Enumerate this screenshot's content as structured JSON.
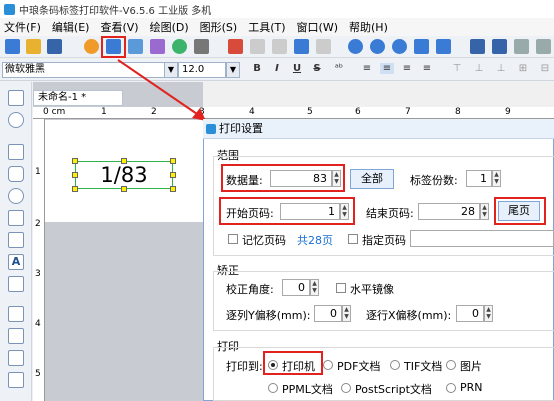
{
  "app": {
    "title": "中琅条码标签打印软件-V6.5.6 工业版 多机"
  },
  "menu": [
    "文件(F)",
    "编辑(E)",
    "查看(V)",
    "绘图(D)",
    "图形(S)",
    "工具(T)",
    "窗口(W)",
    "帮助(H)"
  ],
  "format": {
    "font": "微软雅黑",
    "size": "12.0",
    "bold": "B",
    "italic": "I",
    "underline": "U",
    "strike": "S"
  },
  "document": {
    "tab": "未命名-1 *",
    "label_text": "1/83",
    "ruler_unit": "0 cm",
    "ruler_top": [
      "1",
      "2",
      "3",
      "4",
      "5",
      "6",
      "7",
      "8",
      "9"
    ],
    "ruler_left": [
      "1",
      "2",
      "3",
      "4",
      "5"
    ]
  },
  "dialog": {
    "title": "打印设置",
    "range": {
      "title": "范围",
      "data_count_label": "数据量:",
      "data_count": "83",
      "all_button": "全部",
      "copies_label": "标签份数:",
      "copies": "1",
      "start_label": "开始页码:",
      "start": "1",
      "end_label": "结束页码:",
      "end": "28",
      "last_button": "尾页",
      "remember_label": "记忆页码",
      "total_pages": "共28页",
      "specify_label": "指定页码"
    },
    "correction": {
      "title": "矫正",
      "angle_label": "校正角度:",
      "angle": "0",
      "mirror_label": "水平镜像",
      "y_offset_label": "逐列Y偏移(mm):",
      "y_offset": "0",
      "x_offset_label": "逐行X偏移(mm):",
      "x_offset": "0"
    },
    "print": {
      "title": "打印",
      "print_to_label": "打印到:",
      "options": [
        "打印机",
        "PDF文档",
        "TIF文档",
        "图片",
        "PPML文档",
        "PostScript文档",
        "PRN"
      ],
      "selected": "打印机"
    }
  },
  "colors": {
    "highlight": "#e0231f",
    "accent": "#2a8fd6"
  }
}
